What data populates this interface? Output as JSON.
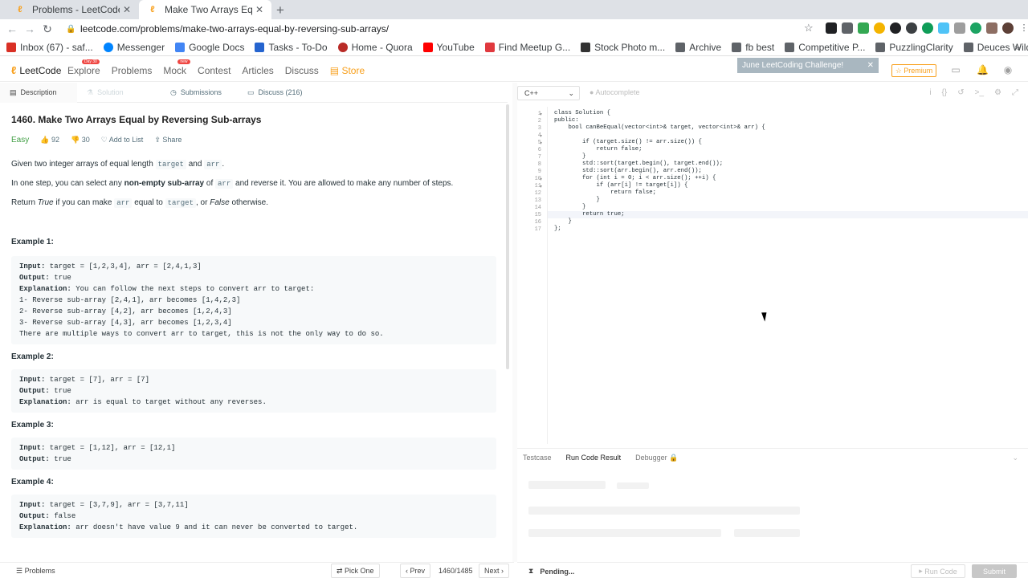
{
  "browser": {
    "tabs": [
      {
        "title": "Problems - LeetCode",
        "close": "✕"
      },
      {
        "title": "Make Two Arrays Equal by",
        "close": "✕"
      }
    ],
    "new_tab": "+",
    "url": "leetcode.com/problems/make-two-arrays-equal-by-reversing-sub-arrays/",
    "bookmarks": [
      "Inbox (67) - saf...",
      "Messenger",
      "Google Docs",
      "Tasks - To-Do",
      "Home - Quora",
      "YouTube",
      "Find Meetup G...",
      "Stock Photo m...",
      "Archive",
      "fb best",
      "Competitive P...",
      "PuzzlingClarity",
      "Deuces Wild S..."
    ],
    "bookmark_colors": [
      "#d93025",
      "#0084ff",
      "#4285f4",
      "#2564cf",
      "#b92b27",
      "#ff0000",
      "#e0393e",
      "#333333",
      "#5f6368",
      "#5f6368",
      "#5f6368",
      "#5f6368",
      "#5f6368"
    ]
  },
  "nav": {
    "logo": "LeetCode",
    "menu": [
      "Explore",
      "Problems",
      "Mock",
      "Contest",
      "Articles",
      "Discuss",
      "Store"
    ],
    "explore_badge": "Day 30",
    "mock_badge": "new",
    "challenge": "June LeetCoding Challenge!",
    "challenge_close": "✕",
    "premium": "Premium"
  },
  "problem_tabs": [
    "Description",
    "Solution",
    "Submissions",
    "Discuss (216)"
  ],
  "problem": {
    "title": "1460. Make Two Arrays Equal by Reversing Sub-arrays",
    "difficulty": "Easy",
    "likes": "92",
    "dislikes": "30",
    "add_to_list": "Add to List",
    "share": "Share",
    "p1_a": "Given two integer arrays of equal length ",
    "p1_code1": "target",
    "p1_b": " and ",
    "p1_code2": "arr",
    "p1_c": ".",
    "p2_a": "In one step, you can select any ",
    "p2_bold": "non-empty sub-array",
    "p2_b": " of ",
    "p2_code": "arr",
    "p2_c": " and reverse it. You are allowed to make any number of steps.",
    "p3_a": "Return ",
    "p3_i1": "True",
    "p3_b": " if you can make ",
    "p3_code1": "arr",
    "p3_c": " equal to ",
    "p3_code2": "target",
    "p3_d": ", or ",
    "p3_i2": "False",
    "p3_e": " otherwise."
  },
  "examples": [
    {
      "title": "Example 1:",
      "lines": [
        {
          "label": "Input:",
          "text": " target = [1,2,3,4], arr = [2,4,1,3]"
        },
        {
          "label": "Output:",
          "text": " true"
        },
        {
          "label": "Explanation:",
          "text": " You can follow the next steps to convert arr to target:"
        },
        {
          "label": "",
          "text": "1- Reverse sub-array [2,4,1], arr becomes [1,4,2,3]"
        },
        {
          "label": "",
          "text": "2- Reverse sub-array [4,2], arr becomes [1,2,4,3]"
        },
        {
          "label": "",
          "text": "3- Reverse sub-array [4,3], arr becomes [1,2,3,4]"
        },
        {
          "label": "",
          "text": "There are multiple ways to convert arr to target, this is not the only way to do so."
        }
      ]
    },
    {
      "title": "Example 2:",
      "lines": [
        {
          "label": "Input:",
          "text": " target = [7], arr = [7]"
        },
        {
          "label": "Output:",
          "text": " true"
        },
        {
          "label": "Explanation:",
          "text": " arr is equal to target without any reverses."
        }
      ]
    },
    {
      "title": "Example 3:",
      "lines": [
        {
          "label": "Input:",
          "text": " target = [1,12], arr = [12,1]"
        },
        {
          "label": "Output:",
          "text": " true"
        }
      ]
    },
    {
      "title": "Example 4:",
      "lines": [
        {
          "label": "Input:",
          "text": " target = [3,7,9], arr = [3,7,11]"
        },
        {
          "label": "Output:",
          "text": " false"
        },
        {
          "label": "Explanation:",
          "text": " arr doesn't have value 9 and it can never be converted to target."
        }
      ]
    }
  ],
  "footer_left": {
    "problems": "Problems",
    "pick_one": "Pick One",
    "prev": "Prev",
    "page": "1460/1485",
    "next": "Next"
  },
  "editor": {
    "language": "C++",
    "autocomplete": "Autocomplete",
    "code": [
      "class Solution {",
      "public:",
      "    bool canBeEqual(vector<int>& target, vector<int>& arr) {",
      "        ",
      "        if (target.size() != arr.size()) {",
      "            return false;",
      "        }",
      "        std::sort(target.begin(), target.end());",
      "        std::sort(arr.begin(), arr.end());",
      "        for (int i = 0; i < arr.size(); ++i) {",
      "            if (arr[i] != target[i]) {",
      "                return false;",
      "            }",
      "        }",
      "        return true;",
      "    }",
      "};"
    ],
    "current_line": 15
  },
  "bottom": {
    "tabs": [
      "Testcase",
      "Run Code Result",
      "Debugger"
    ],
    "pending": "Pending...",
    "run_code": "Run Code",
    "submit": "Submit"
  }
}
